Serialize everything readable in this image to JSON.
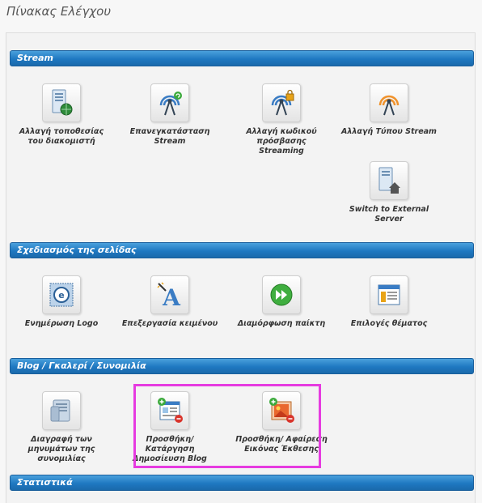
{
  "page": {
    "title": "Πίνακας Ελέγχου"
  },
  "sections": {
    "stream": {
      "title": "Stream",
      "items": [
        {
          "label": "Αλλαγή τοποθεσίας του διακομιστή",
          "icon": "server-globe-icon"
        },
        {
          "label": "Επανεγκατάσταση Stream",
          "icon": "antenna-refresh-icon"
        },
        {
          "label": "Αλλαγή κωδικού πρόσβασης Streaming",
          "icon": "antenna-lock-icon"
        },
        {
          "label": "Αλλαγή Τύπου Stream",
          "icon": "antenna-orange-icon"
        },
        {
          "label": "Switch to External Server",
          "icon": "server-home-icon"
        }
      ]
    },
    "design": {
      "title": "Σχεδιασμός της σελίδας",
      "items": [
        {
          "label": "Ενημέρωση Logo",
          "icon": "logo-icon"
        },
        {
          "label": "Επεξεργασία κειμένου",
          "icon": "text-edit-icon"
        },
        {
          "label": "Διαμόρφωση παίκτη",
          "icon": "player-icon"
        },
        {
          "label": "Επιλογές θέματος",
          "icon": "theme-icon"
        }
      ]
    },
    "blog": {
      "title": "Blog / Γκαλερί / Συνομιλία",
      "items": [
        {
          "label": "Διαγραφή των μηνυμάτων της συνομιλίας",
          "icon": "chat-delete-icon"
        },
        {
          "label": "Προσθήκη/ Κατάργηση Δημοσίευση Blog",
          "icon": "blog-add-remove-icon"
        },
        {
          "label": "Προσθήκη/ Αφαίρεση Εικόνας Έκθεσης",
          "icon": "image-add-remove-icon"
        }
      ]
    },
    "stats": {
      "title": "Στατιστικά"
    }
  },
  "colors": {
    "accent": "#1f78c1",
    "highlight": "#e63be0"
  }
}
